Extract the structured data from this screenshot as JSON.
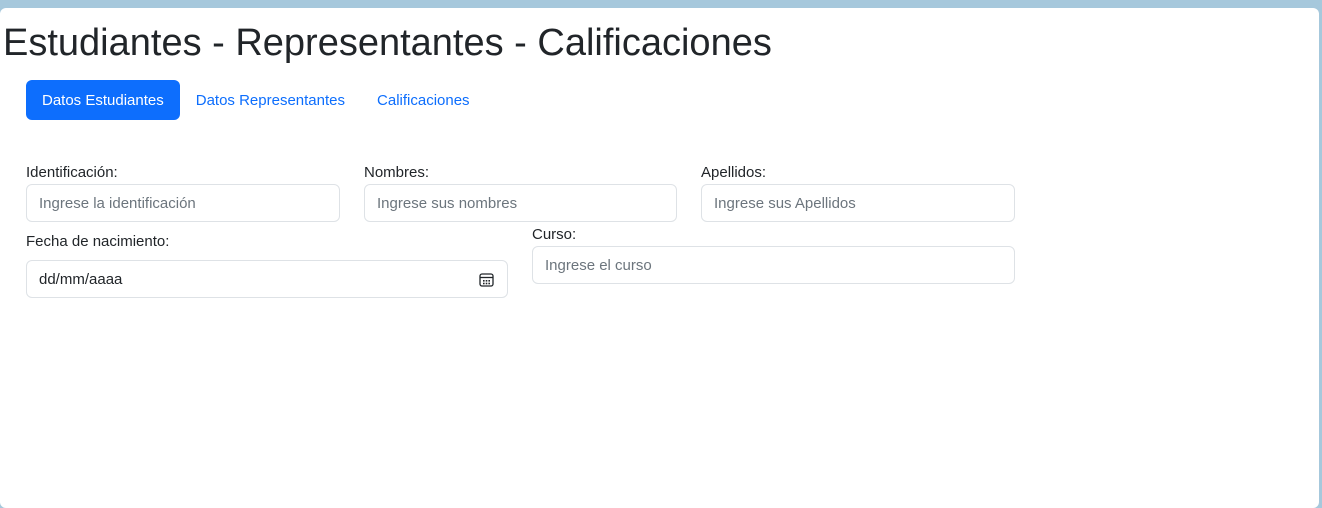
{
  "header": {
    "title": "Estudiantes - Representantes - Calificaciones"
  },
  "tabs": [
    {
      "label": "Datos Estudiantes",
      "active": true
    },
    {
      "label": "Datos Representantes",
      "active": false
    },
    {
      "label": "Calificaciones",
      "active": false
    }
  ],
  "form": {
    "identificacion": {
      "label": "Identificación:",
      "placeholder": "Ingrese la identificación"
    },
    "nombres": {
      "label": "Nombres:",
      "placeholder": "Ingrese sus nombres"
    },
    "apellidos": {
      "label": "Apellidos:",
      "placeholder": "Ingrese sus Apellidos"
    },
    "fecha_nacimiento": {
      "label": "Fecha de nacimiento:",
      "value": "dd/mm/aaaa",
      "icon": "calendar-icon"
    },
    "curso": {
      "label": "Curso:",
      "placeholder": "Ingrese el curso"
    }
  },
  "colors": {
    "accent": "#0d6efd",
    "background": "#a6c8dc",
    "text": "#212529",
    "placeholder": "#6c757d",
    "border": "#dee2e6"
  }
}
